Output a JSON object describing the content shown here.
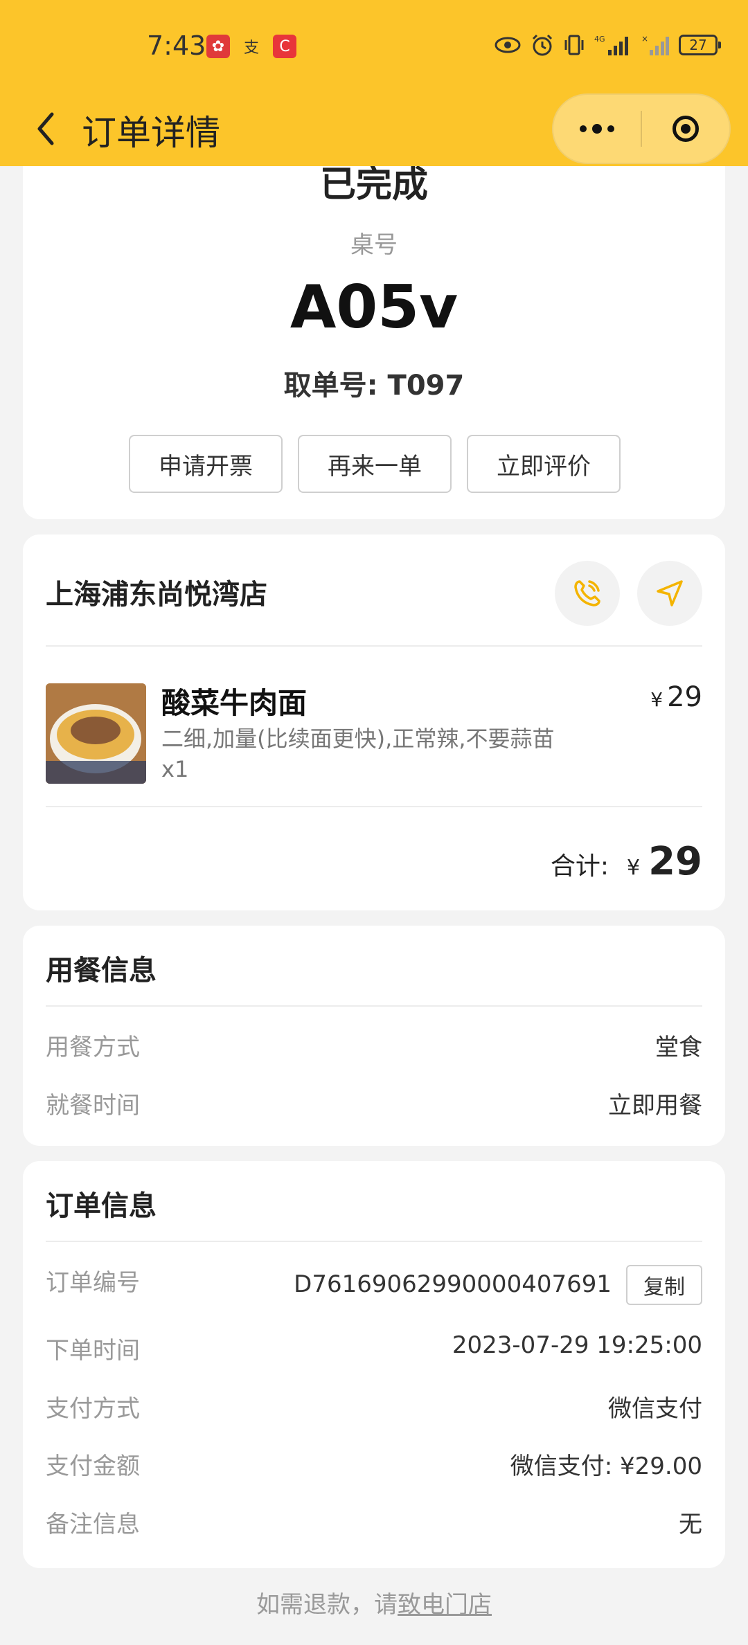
{
  "status_bar": {
    "time": "7:43",
    "battery": "27"
  },
  "nav": {
    "title": "订单详情"
  },
  "order_status": {
    "status": "已完成",
    "table_label": "桌号",
    "table_no": "A05v",
    "pickup_label": "取单号: T097",
    "buttons": [
      "申请开票",
      "再来一单",
      "立即评价"
    ]
  },
  "store": {
    "name": "上海浦东尚悦湾店",
    "item": {
      "name": "酸菜牛肉面",
      "spec": "二细,加量(比续面更快),正常辣,不要蒜苗",
      "qty": "x1",
      "currency": "¥",
      "price": "29"
    },
    "total_label": "合计:",
    "total_currency": "¥",
    "total": "29"
  },
  "dining": {
    "title": "用餐信息",
    "rows": [
      {
        "label": "用餐方式",
        "value": "堂食"
      },
      {
        "label": "就餐时间",
        "value": "立即用餐"
      }
    ]
  },
  "order": {
    "title": "订单信息",
    "order_no_label": "订单编号",
    "order_no": "D7616906299000040769​1",
    "copy_label": "复制",
    "rows": [
      {
        "label": "下单时间",
        "value": "2023-07-29 19:25:00"
      },
      {
        "label": "支付方式",
        "value": "微信支付"
      },
      {
        "label": "支付金额",
        "value": "微信支付: ¥29.00"
      },
      {
        "label": "备注信息",
        "value": "无"
      }
    ]
  },
  "footer": {
    "prefix": "如需退款，请",
    "link": "致电门店"
  },
  "colors": {
    "brand_yellow": "#fcc52a",
    "icon_yellow": "#f4b400"
  }
}
